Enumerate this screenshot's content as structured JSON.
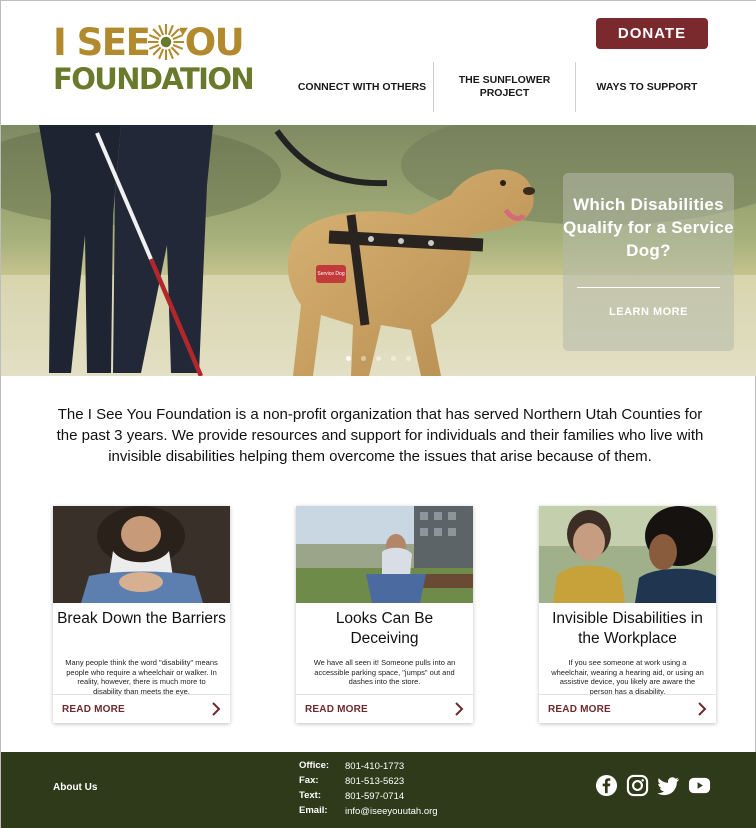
{
  "brand": {
    "logo_top": "I SEE YOU",
    "logo_bottom": "FOUNDATION",
    "colors": {
      "gold": "#b28a2e",
      "olive": "#6a7a2c",
      "maroon": "#7a2a2c",
      "footer": "#2e3a1a"
    }
  },
  "header": {
    "donate_label": "DONATE",
    "nav": [
      {
        "label": "CONNECT WITH OTHERS"
      },
      {
        "label": "THE SUNFLOWER PROJECT"
      },
      {
        "label": "WAYS TO SUPPORT"
      }
    ]
  },
  "hero": {
    "title": "Which Disabilities Qualify for a Service Dog?",
    "cta": "LEARN MORE",
    "tag_text": "Service Dog",
    "slide_count": 5,
    "active_slide": 1
  },
  "intro": {
    "text": "The I See You Foundation is a non-profit organization that has served Northern Utah Counties for the past 3 years. We provide resources and support for individuals and their families who live with invisible disabilities helping them overcome the issues that arise because of them."
  },
  "cards": [
    {
      "title": "Break Down the Barriers",
      "text": "Many people think the word \"disability\" means people who require a wheelchair or walker. In reality, however, there is much more to disability than meets the eye.",
      "link": "READ MORE",
      "icon": "chevron-right-icon"
    },
    {
      "title": "Looks Can Be Deceiving",
      "text": "We have all seen it! Someone pulls into an accessible parking space, \"jumps\" out and dashes into the store.",
      "link": "READ MORE",
      "icon": "chevron-right-icon"
    },
    {
      "title": "Invisible Disabilities in the Workplace",
      "text": "If you see someone at work using a wheelchair, wearing a hearing aid, or using an assistive device, you likely are aware the person has a disability.",
      "link": "READ MORE",
      "icon": "chevron-right-icon"
    }
  ],
  "footer": {
    "about": "About Us",
    "contact": [
      {
        "label": "Office:",
        "value": "801-410-1773"
      },
      {
        "label": "Fax:",
        "value": "801-513-5623"
      },
      {
        "label": "Text:",
        "value": "801-597-0714"
      },
      {
        "label": "Email:",
        "value": "info@iseeyouutah.org"
      }
    ],
    "social": [
      "facebook-icon",
      "instagram-icon",
      "twitter-icon",
      "youtube-icon"
    ]
  }
}
